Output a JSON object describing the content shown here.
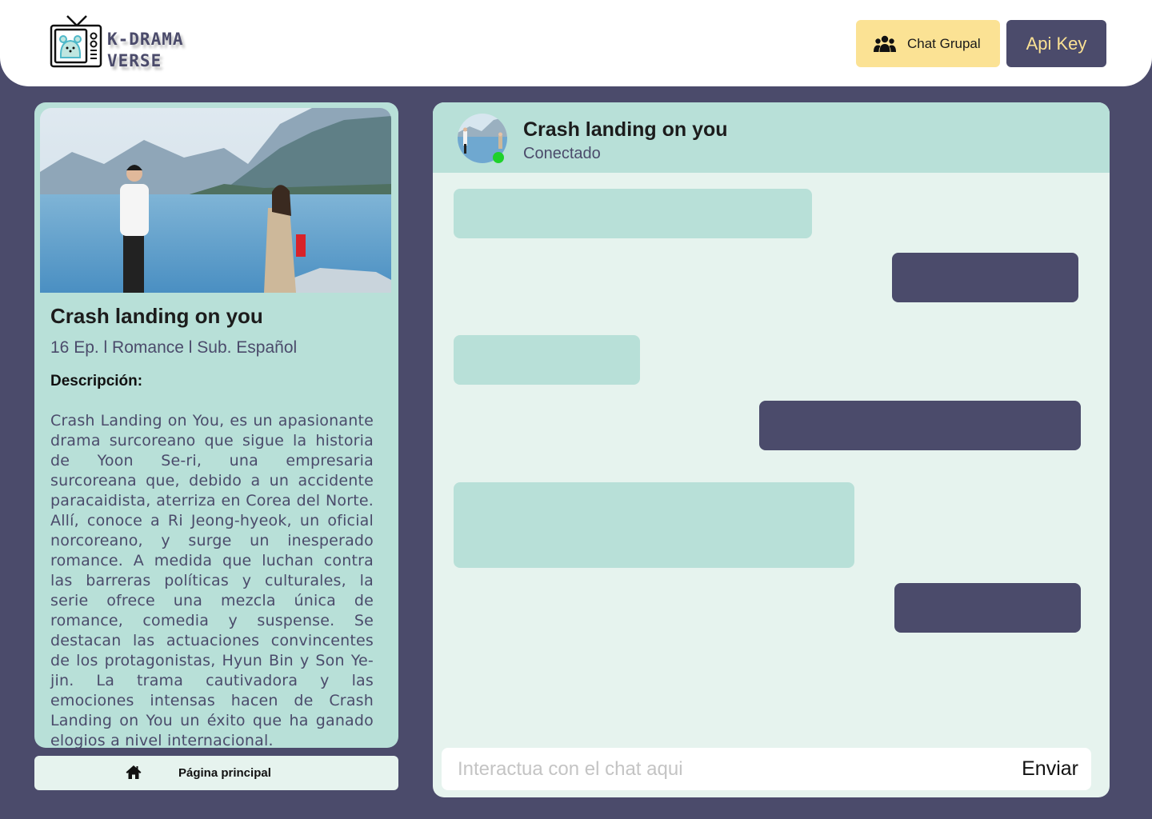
{
  "brand": {
    "line1": "K-DRAMA",
    "line2": "VERSE"
  },
  "header": {
    "group_chat_label": "Chat Grupal",
    "api_key_label": "Api Key"
  },
  "drama": {
    "title": "Crash landing on you",
    "meta": "16 Ep. l Romance l Sub. Español",
    "description_label": "Descripción:",
    "description": "Crash Landing on You, es un apasionante drama surcoreano que sigue la historia de Yoon Se-ri, una empresaria surcoreana que, debido a un accidente paracaidista, aterriza en Corea del Norte. Allí, conoce a Ri Jeong-hyeok, un oficial norcoreano, y surge un inesperado romance. A medida que luchan contra las barreras políticas y culturales, la serie ofrece una mezcla única de romance, comedia y suspense. Se destacan las actuaciones convincentes de los protagonistas, Hyun Bin y Son Ye-jin. La trama cautivadora y las emociones intensas hacen de Crash Landing on You un éxito que ha ganado elogios a nivel internacional."
  },
  "nav": {
    "home_label": "Página principal"
  },
  "chat": {
    "title": "Crash landing on you",
    "status": "Conectado",
    "input_placeholder": "Interactua con el chat aqui",
    "send_label": "Enviar",
    "messages": [
      {
        "from": "bot",
        "text": ""
      },
      {
        "from": "user",
        "text": ""
      },
      {
        "from": "bot",
        "text": ""
      },
      {
        "from": "user",
        "text": ""
      },
      {
        "from": "bot",
        "text": ""
      },
      {
        "from": "user",
        "text": ""
      }
    ]
  },
  "colors": {
    "background": "#4b4b6b",
    "accent_yellow": "#fbe294",
    "mint": "#b8e0d8",
    "mint_light": "#e6f3ee",
    "online": "#1fd12c"
  },
  "icons": [
    "tv-logo-icon",
    "group-icon",
    "home-icon"
  ]
}
